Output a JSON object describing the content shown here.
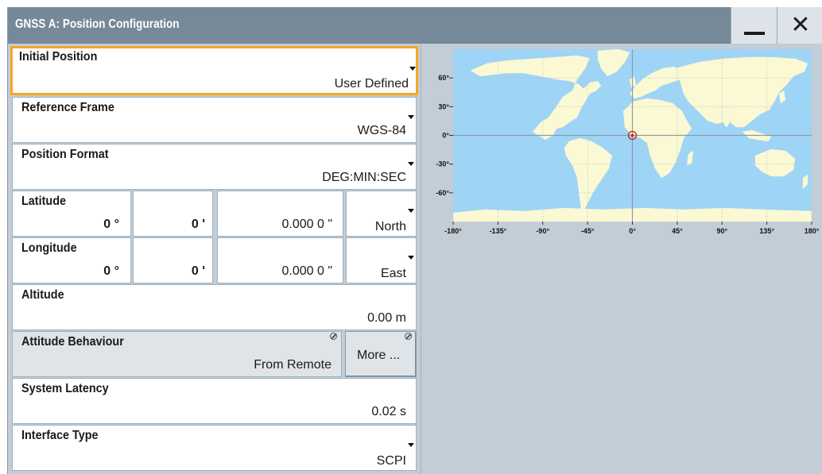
{
  "window": {
    "title": "GNSS A: Position Configuration",
    "minimize_icon": "minimize-icon",
    "close_icon": "close-icon",
    "close_glyph": "✕"
  },
  "fields": {
    "initial_position": {
      "label": "Initial Position",
      "value": "User Defined"
    },
    "reference_frame": {
      "label": "Reference Frame",
      "value": "WGS-84"
    },
    "position_format": {
      "label": "Position Format",
      "value": "DEG:MIN:SEC"
    },
    "latitude": {
      "label": "Latitude",
      "deg": "0 °",
      "min": "0 '",
      "sec": "0.000 0 \"",
      "direction": "North"
    },
    "longitude": {
      "label": "Longitude",
      "deg": "0 °",
      "min": "0 '",
      "sec": "0.000 0 \"",
      "direction": "East"
    },
    "altitude": {
      "label": "Altitude",
      "value": "0.00 m"
    },
    "attitude_behaviour": {
      "label": "Attitude Behaviour",
      "value": "From Remote"
    },
    "more_button": {
      "label": "More ..."
    },
    "system_latency": {
      "label": "System Latency",
      "value": "0.02 s"
    },
    "interface_type": {
      "label": "Interface Type",
      "value": "SCPI"
    }
  },
  "map": {
    "lat_ticks": [
      "60°",
      "30°",
      "0°",
      "-30°",
      "-60°"
    ],
    "lon_ticks": [
      "-180°",
      "-135°",
      "-90°",
      "-45°",
      "0°",
      "45°",
      "90°",
      "135°",
      "180°"
    ],
    "marker": {
      "latitude": 0,
      "longitude": 0
    },
    "colors": {
      "ocean": "#9ed4f6",
      "land": "#fbf9d3",
      "marker": "#d22020"
    }
  }
}
